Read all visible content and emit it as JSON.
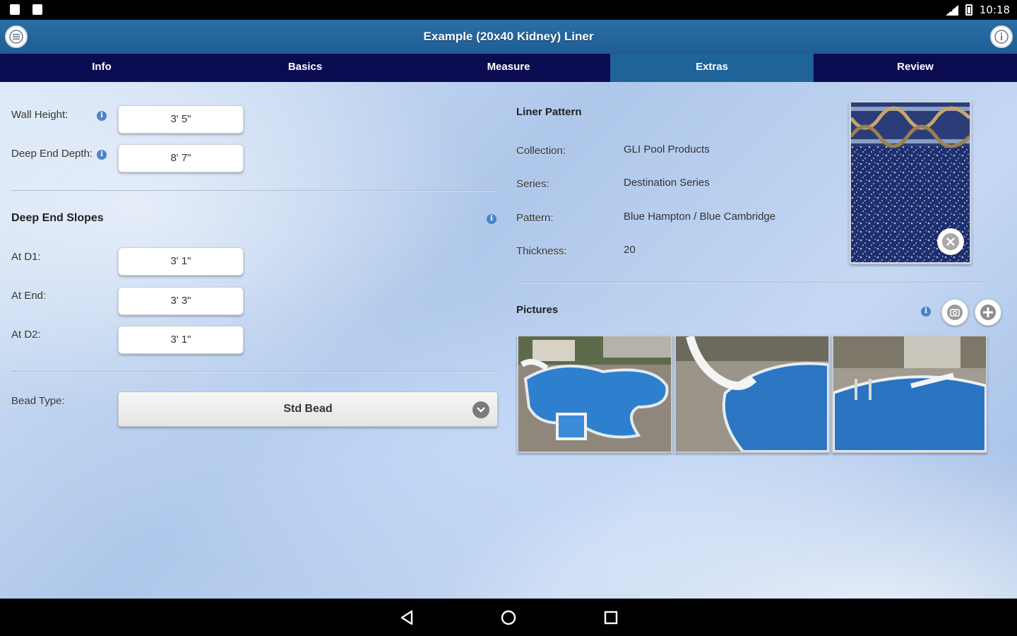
{
  "status_bar": {
    "time": "10:18"
  },
  "header": {
    "title": "Example (20x40 Kidney) Liner"
  },
  "tabs": [
    {
      "label": "Info"
    },
    {
      "label": "Basics"
    },
    {
      "label": "Measure"
    },
    {
      "label": "Extras",
      "active": true
    },
    {
      "label": "Review"
    }
  ],
  "left": {
    "wall_height": {
      "label": "Wall Height:",
      "value": "3' 5\""
    },
    "deep_end_depth": {
      "label": "Deep End Depth:",
      "value": "8' 7\""
    },
    "slopes_title": "Deep End Slopes",
    "at_d1": {
      "label": "At D1:",
      "value": "3' 1\""
    },
    "at_end": {
      "label": "At End:",
      "value": "3' 3\""
    },
    "at_d2": {
      "label": "At D2:",
      "value": "3' 1\""
    },
    "bead_type": {
      "label": "Bead Type:",
      "value": "Std Bead"
    }
  },
  "right": {
    "liner_title": "Liner Pattern",
    "collection": {
      "label": "Collection:",
      "value": "GLI Pool Products"
    },
    "series": {
      "label": "Series:",
      "value": "Destination Series"
    },
    "pattern": {
      "label": "Pattern:",
      "value": "Blue Hampton / Blue Cambridge"
    },
    "thickness": {
      "label": "Thickness:",
      "value": "20"
    },
    "pictures_title": "Pictures"
  },
  "colors": {
    "header": "#1e5d94",
    "tab_bar": "#0b0b52",
    "tab_active": "#1e6399",
    "info_icon": "#4a86c5"
  }
}
